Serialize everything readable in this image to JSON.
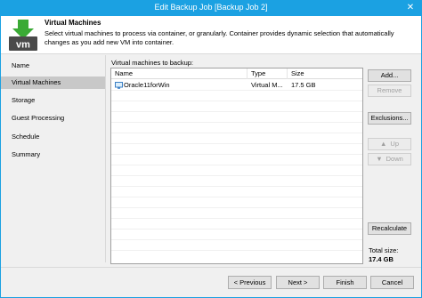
{
  "window": {
    "title": "Edit Backup Job [Backup Job 2]",
    "close_glyph": "✕",
    "accent_color": "#1ba1e2"
  },
  "header": {
    "icon": "vm-arrow-icon",
    "icon_text": "vm",
    "heading": "Virtual Machines",
    "description": "Select virtual machines to process via container, or granularly. Container provides dynamic selection that automatically changes as you add new VM into container."
  },
  "sidebar": {
    "steps": [
      {
        "label": "Name"
      },
      {
        "label": "Virtual Machines",
        "active": true
      },
      {
        "label": "Storage"
      },
      {
        "label": "Guest Processing"
      },
      {
        "label": "Schedule"
      },
      {
        "label": "Summary"
      }
    ]
  },
  "vm_grid": {
    "label": "Virtual machines to backup:",
    "columns": [
      "Name",
      "Type",
      "Size"
    ],
    "rows": [
      {
        "name": "Oracle11forWin",
        "type": "Virtual M...",
        "size": "17.5 GB",
        "icon": "vm-icon"
      }
    ]
  },
  "side_buttons": {
    "add": "Add...",
    "remove": "Remove",
    "exclusions": "Exclusions...",
    "up": "Up",
    "down": "Down",
    "recalculate": "Recalculate"
  },
  "total": {
    "label": "Total size:",
    "value": "17.4 GB"
  },
  "footer": {
    "previous": "< Previous",
    "next": "Next >",
    "finish": "Finish",
    "cancel": "Cancel"
  }
}
